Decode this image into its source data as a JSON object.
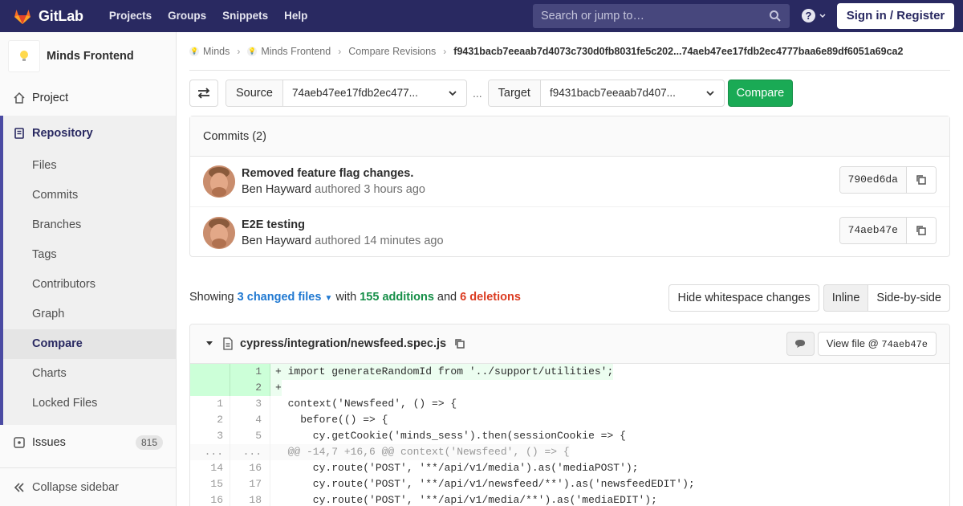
{
  "navbar": {
    "brand": "GitLab",
    "links": [
      "Projects",
      "Groups",
      "Snippets",
      "Help"
    ],
    "search_placeholder": "Search or jump to…",
    "help_glyph": "?",
    "signin_label": "Sign in / Register"
  },
  "sidebar": {
    "project_name": "Minds Frontend",
    "project_item": "Project",
    "repository_label": "Repository",
    "repo_items": [
      "Files",
      "Commits",
      "Branches",
      "Tags",
      "Contributors",
      "Graph",
      "Compare",
      "Charts",
      "Locked Files"
    ],
    "active_item": "Compare",
    "issues_label": "Issues",
    "issues_count": "815",
    "collapse_label": "Collapse sidebar"
  },
  "breadcrumb": {
    "items": [
      "Minds",
      "Minds Frontend",
      "Compare Revisions"
    ],
    "current": "f9431bacb7eeaab7d4073c730d0fb8031fe5c202...74aeb47ee17fdb2ec4777baa6e89df6051a69ca2"
  },
  "compare": {
    "source_label": "Source",
    "source_value": "74aeb47ee17fdb2ec477...",
    "separator": "...",
    "target_label": "Target",
    "target_value": "f9431bacb7eeaab7d407...",
    "compare_label": "Compare"
  },
  "commits": {
    "header": "Commits (2)",
    "items": [
      {
        "title": "Removed feature flag changes.",
        "author": "Ben Hayward",
        "verb": "authored",
        "time": "3 hours ago",
        "sha": "790ed6da"
      },
      {
        "title": "E2E testing",
        "author": "Ben Hayward",
        "verb": "authored",
        "time": "14 minutes ago",
        "sha": "74aeb47e"
      }
    ]
  },
  "stats": {
    "showing": "Showing",
    "changed_files": "3 changed files",
    "with": "with",
    "additions": "155 additions",
    "and": "and",
    "deletions": "6 deletions"
  },
  "view_options": {
    "hide_whitespace": "Hide whitespace changes",
    "inline": "Inline",
    "side_by_side": "Side-by-side"
  },
  "file": {
    "path": "cypress/integration/newsfeed.spec.js",
    "view_file_label": "View file @",
    "view_file_sha": "74aeb47e"
  },
  "diff_lines": [
    {
      "old": "",
      "new": "1",
      "type": "new",
      "text": "+ import generateRandomId from '../support/utilities';"
    },
    {
      "old": "",
      "new": "2",
      "type": "new",
      "text": "+"
    },
    {
      "old": "1",
      "new": "3",
      "type": "ctx",
      "text": "  context('Newsfeed', () => {"
    },
    {
      "old": "2",
      "new": "4",
      "type": "ctx",
      "text": "    before(() => {"
    },
    {
      "old": "3",
      "new": "5",
      "type": "ctx",
      "text": "      cy.getCookie('minds_sess').then(sessionCookie => {"
    },
    {
      "old": "...",
      "new": "...",
      "type": "match",
      "text": "  @@ -14,7 +16,6 @@ context('Newsfeed', () => {"
    },
    {
      "old": "14",
      "new": "16",
      "type": "ctx",
      "text": "      cy.route('POST', '**/api/v1/media').as('mediaPOST');"
    },
    {
      "old": "15",
      "new": "17",
      "type": "ctx",
      "text": "      cy.route('POST', '**/api/v1/newsfeed/**').as('newsfeedEDIT');"
    },
    {
      "old": "16",
      "new": "18",
      "type": "ctx",
      "text": "      cy.route('POST', '**/api/v1/media/**').as('mediaEDIT');"
    }
  ],
  "colors": {
    "navbar": "#292961",
    "accent_green": "#1aaa55",
    "link_blue": "#1f78d1",
    "deletion_red": "#db3b21"
  }
}
